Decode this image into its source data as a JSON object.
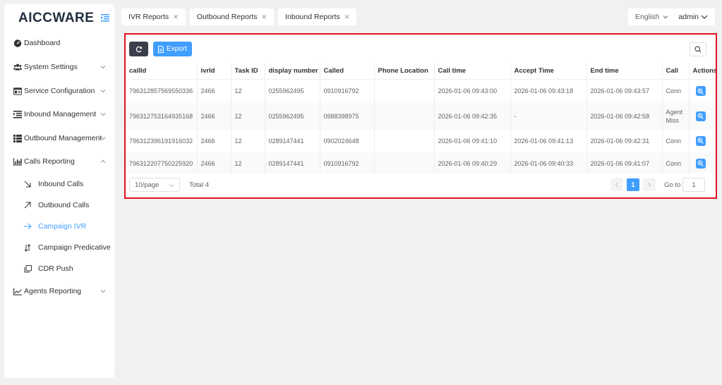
{
  "app": {
    "logo": "AICCWARE"
  },
  "sidebar": {
    "items": [
      {
        "label": "Dashboard",
        "icon": "tachometer-icon"
      },
      {
        "label": "System Settings",
        "icon": "users-icon"
      },
      {
        "label": "Service Configuration",
        "icon": "id-card-icon"
      },
      {
        "label": "Inbound Management",
        "icon": "indent-icon"
      },
      {
        "label": "Outbound Management",
        "icon": "list-icon"
      },
      {
        "label": "Calls Reporting",
        "icon": "bar-chart-icon"
      },
      {
        "label": "Agents Reporting",
        "icon": "line-chart-icon"
      }
    ],
    "calls_reporting_children": [
      {
        "label": "Inbound Calls",
        "icon": "arrow-down-right-icon"
      },
      {
        "label": "Outbound Calls",
        "icon": "arrow-up-right-icon"
      },
      {
        "label": "Campaign IVR",
        "icon": "arrow-right-icon"
      },
      {
        "label": "Campaign Predicative",
        "icon": "arrows-updown-icon"
      },
      {
        "label": "CDR Push",
        "icon": "copy-icon"
      }
    ]
  },
  "tabs": [
    {
      "label": "IVR Reports"
    },
    {
      "label": "Outbound Reports"
    },
    {
      "label": "Inbound Reports"
    }
  ],
  "header": {
    "language": "English",
    "user": "admin"
  },
  "toolbar": {
    "export_label": "Export"
  },
  "table": {
    "columns": [
      "callId",
      "ivrId",
      "Task ID",
      "display number",
      "Called",
      "Phone Location",
      "Call time",
      "Accept Time",
      "End time",
      "Call",
      "Actions"
    ],
    "rows": [
      [
        "796312857569550336",
        "2466",
        "12",
        "0255962495",
        "0910916792",
        "",
        "2026-01-06 09:43:00",
        "2026-01-06 09:43:18",
        "2026-01-06 09:43:57",
        "Conn"
      ],
      [
        "796312753164935168",
        "2466",
        "12",
        "0255962495",
        "0988398975",
        "",
        "2026-01-06 09:42:35",
        "-",
        "2026-01-06 09:42:58",
        "Agent Miss"
      ],
      [
        "796312396191916032",
        "2466",
        "12",
        "0289147441",
        "0902024648",
        "",
        "2026-01-06 09:41:10",
        "2026-01-06 09:41:13",
        "2026-01-06 09:42:31",
        "Conn"
      ],
      [
        "796312207750225920",
        "2466",
        "12",
        "0289147441",
        "0910916792",
        "",
        "2026-01-06 09:40:29",
        "2026-01-06 09:40:33",
        "2026-01-06 09:41:07",
        "Conn"
      ]
    ]
  },
  "pagination": {
    "page_size": "10/page",
    "total": "Total 4",
    "current_page": "1",
    "goto_label": "Go to",
    "goto_value": "1"
  },
  "colors": {
    "accent": "#409eff",
    "highlight_border": "#e0121a",
    "dark_button": "#3a3f4b"
  }
}
